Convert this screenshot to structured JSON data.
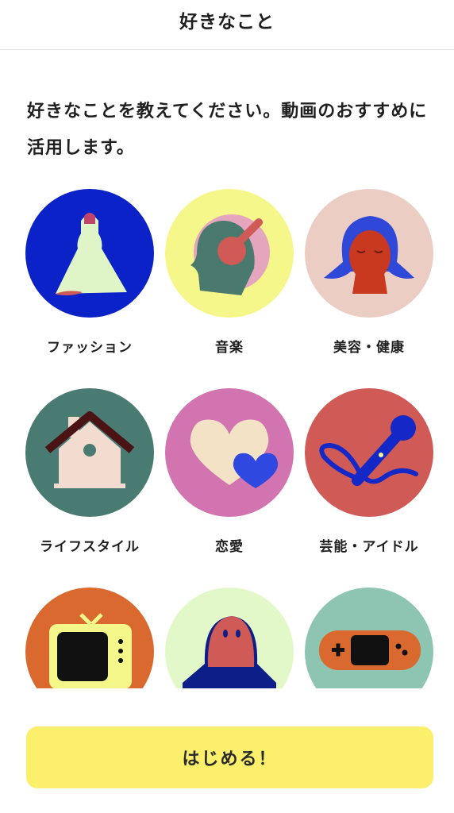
{
  "header": {
    "title": "好きなこと"
  },
  "intro": {
    "text": "好きなことを教えてください。動画のおすすめに活用します。"
  },
  "categories": [
    {
      "label": "ファッション",
      "icon": "dress-icon",
      "color": "#0a22c8"
    },
    {
      "label": "音楽",
      "icon": "headphones-icon",
      "color": "#f5f78a"
    },
    {
      "label": "美容・健康",
      "icon": "face-icon",
      "color": "#eccdc4"
    },
    {
      "label": "ライフスタイル",
      "icon": "house-icon",
      "color": "#4a7b73"
    },
    {
      "label": "恋愛",
      "icon": "heart-icon",
      "color": "#d274b0"
    },
    {
      "label": "芸能・アイドル",
      "icon": "microphone-icon",
      "color": "#d05a55"
    },
    {
      "label": "",
      "icon": "tv-icon",
      "color": "#d9692e"
    },
    {
      "label": "",
      "icon": "ghost-icon",
      "color": "#e3f8c9"
    },
    {
      "label": "",
      "icon": "game-console-icon",
      "color": "#8ec5b2"
    }
  ],
  "start_button": {
    "label": "はじめる！",
    "color": "#fbef6c"
  }
}
